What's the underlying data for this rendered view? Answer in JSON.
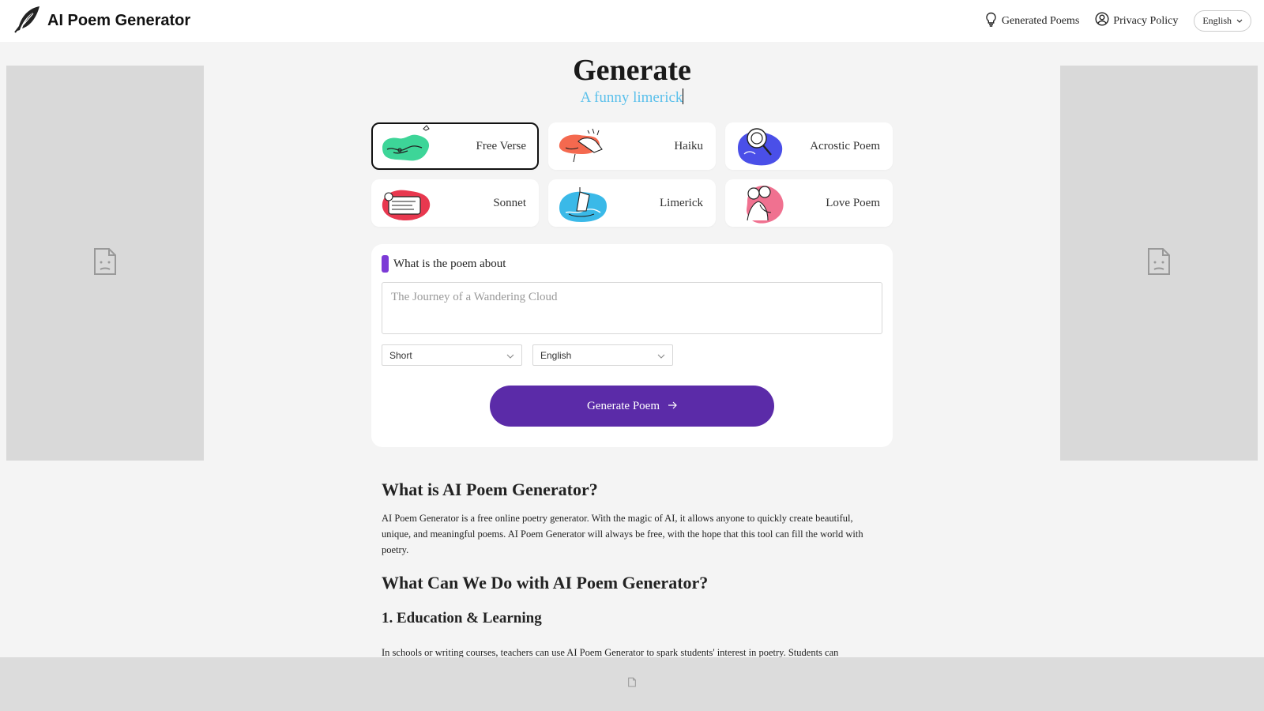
{
  "header": {
    "title": "AI Poem Generator",
    "nav": {
      "generated_poems": "Generated Poems",
      "privacy_policy": "Privacy Policy",
      "language": "English"
    }
  },
  "hero": {
    "title": "Generate",
    "subtitle": "A funny limerick"
  },
  "poem_types": [
    {
      "label": "Free Verse",
      "selected": true
    },
    {
      "label": "Haiku",
      "selected": false
    },
    {
      "label": "Acrostic Poem",
      "selected": false
    },
    {
      "label": "Sonnet",
      "selected": false
    },
    {
      "label": "Limerick",
      "selected": false
    },
    {
      "label": "Love Poem",
      "selected": false
    }
  ],
  "form": {
    "heading": "What is the poem about",
    "topic_placeholder": "The Journey of a Wandering Cloud",
    "length_value": "Short",
    "language_value": "English",
    "generate_label": "Generate Poem"
  },
  "article": {
    "h1": "What is AI Poem Generator?",
    "p1": "AI Poem Generator is a free online poetry generator. With the magic of AI, it allows anyone to quickly create beautiful, unique, and meaningful poems. AI Poem Generator will always be free, with the hope that this tool can fill the world with poetry.",
    "h2": "What Can We Do with AI Poem Generator?",
    "h3": "1. Education & Learning",
    "p2": "In schools or writing courses, teachers can use AI Poem Generator to spark students' interest in poetry. Students can"
  },
  "colors": {
    "accent_purple": "#5b2ba8",
    "subtitle_blue": "#5bc0eb",
    "marker_purple": "#7c3ad6"
  }
}
